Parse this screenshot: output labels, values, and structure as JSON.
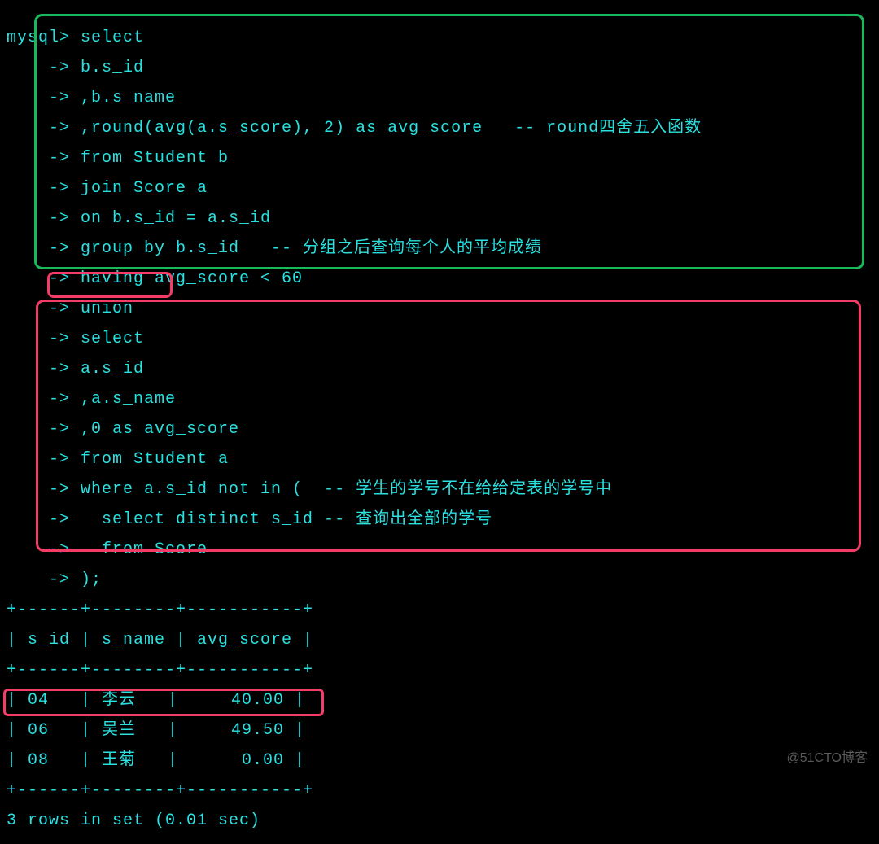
{
  "prompt": "mysql> ",
  "cont": "    -> ",
  "query1": {
    "l0": "select",
    "l1": "b.s_id",
    "l2": ",b.s_name",
    "l3": ",round(avg(a.s_score), 2) as avg_score   -- round四舍五入函数",
    "l4": "from Student b",
    "l5": "join Score a",
    "l6": "on b.s_id = a.s_id",
    "l7": "group by b.s_id   -- 分组之后查询每个人的平均成绩",
    "l8": "having avg_score < 60"
  },
  "union": "union",
  "query2": {
    "l0": "select",
    "l1": "a.s_id",
    "l2": ",a.s_name",
    "l3": ",0 as avg_score",
    "l4": "from Student a",
    "l5": "where a.s_id not in (  -- 学生的学号不在给给定表的学号中",
    "l6": "  select distinct s_id -- 查询出全部的学号",
    "l7": "  from Score",
    "l8": ");"
  },
  "table": {
    "border": "+------+--------+-----------+",
    "header": "| s_id | s_name | avg_score |",
    "rows": [
      "| 04   | 李云   |     40.00 |",
      "| 06   | 吴兰   |     49.50 |",
      "| 08   | 王菊   |      0.00 |"
    ]
  },
  "footer": "3 rows in set (0.01 sec)",
  "watermark": "@51CTO博客",
  "chart_data": {
    "type": "table",
    "columns": [
      "s_id",
      "s_name",
      "avg_score"
    ],
    "rows": [
      {
        "s_id": "04",
        "s_name": "李云",
        "avg_score": 40.0
      },
      {
        "s_id": "06",
        "s_name": "吴兰",
        "avg_score": 49.5
      },
      {
        "s_id": "08",
        "s_name": "王菊",
        "avg_score": 0.0
      }
    ]
  }
}
